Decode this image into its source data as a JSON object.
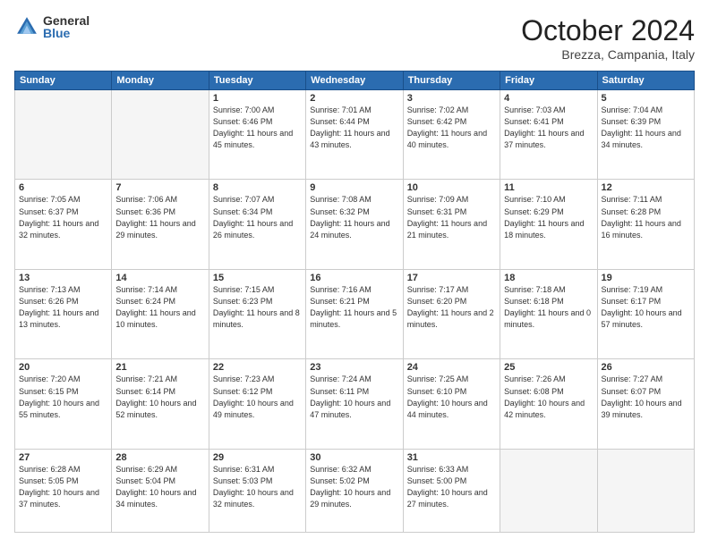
{
  "header": {
    "logo_general": "General",
    "logo_blue": "Blue",
    "month_title": "October 2024",
    "location": "Brezza, Campania, Italy"
  },
  "days_of_week": [
    "Sunday",
    "Monday",
    "Tuesday",
    "Wednesday",
    "Thursday",
    "Friday",
    "Saturday"
  ],
  "weeks": [
    [
      {
        "day": "",
        "empty": true
      },
      {
        "day": "",
        "empty": true
      },
      {
        "day": "1",
        "sunrise": "Sunrise: 7:00 AM",
        "sunset": "Sunset: 6:46 PM",
        "daylight": "Daylight: 11 hours and 45 minutes."
      },
      {
        "day": "2",
        "sunrise": "Sunrise: 7:01 AM",
        "sunset": "Sunset: 6:44 PM",
        "daylight": "Daylight: 11 hours and 43 minutes."
      },
      {
        "day": "3",
        "sunrise": "Sunrise: 7:02 AM",
        "sunset": "Sunset: 6:42 PM",
        "daylight": "Daylight: 11 hours and 40 minutes."
      },
      {
        "day": "4",
        "sunrise": "Sunrise: 7:03 AM",
        "sunset": "Sunset: 6:41 PM",
        "daylight": "Daylight: 11 hours and 37 minutes."
      },
      {
        "day": "5",
        "sunrise": "Sunrise: 7:04 AM",
        "sunset": "Sunset: 6:39 PM",
        "daylight": "Daylight: 11 hours and 34 minutes."
      }
    ],
    [
      {
        "day": "6",
        "sunrise": "Sunrise: 7:05 AM",
        "sunset": "Sunset: 6:37 PM",
        "daylight": "Daylight: 11 hours and 32 minutes."
      },
      {
        "day": "7",
        "sunrise": "Sunrise: 7:06 AM",
        "sunset": "Sunset: 6:36 PM",
        "daylight": "Daylight: 11 hours and 29 minutes."
      },
      {
        "day": "8",
        "sunrise": "Sunrise: 7:07 AM",
        "sunset": "Sunset: 6:34 PM",
        "daylight": "Daylight: 11 hours and 26 minutes."
      },
      {
        "day": "9",
        "sunrise": "Sunrise: 7:08 AM",
        "sunset": "Sunset: 6:32 PM",
        "daylight": "Daylight: 11 hours and 24 minutes."
      },
      {
        "day": "10",
        "sunrise": "Sunrise: 7:09 AM",
        "sunset": "Sunset: 6:31 PM",
        "daylight": "Daylight: 11 hours and 21 minutes."
      },
      {
        "day": "11",
        "sunrise": "Sunrise: 7:10 AM",
        "sunset": "Sunset: 6:29 PM",
        "daylight": "Daylight: 11 hours and 18 minutes."
      },
      {
        "day": "12",
        "sunrise": "Sunrise: 7:11 AM",
        "sunset": "Sunset: 6:28 PM",
        "daylight": "Daylight: 11 hours and 16 minutes."
      }
    ],
    [
      {
        "day": "13",
        "sunrise": "Sunrise: 7:13 AM",
        "sunset": "Sunset: 6:26 PM",
        "daylight": "Daylight: 11 hours and 13 minutes."
      },
      {
        "day": "14",
        "sunrise": "Sunrise: 7:14 AM",
        "sunset": "Sunset: 6:24 PM",
        "daylight": "Daylight: 11 hours and 10 minutes."
      },
      {
        "day": "15",
        "sunrise": "Sunrise: 7:15 AM",
        "sunset": "Sunset: 6:23 PM",
        "daylight": "Daylight: 11 hours and 8 minutes."
      },
      {
        "day": "16",
        "sunrise": "Sunrise: 7:16 AM",
        "sunset": "Sunset: 6:21 PM",
        "daylight": "Daylight: 11 hours and 5 minutes."
      },
      {
        "day": "17",
        "sunrise": "Sunrise: 7:17 AM",
        "sunset": "Sunset: 6:20 PM",
        "daylight": "Daylight: 11 hours and 2 minutes."
      },
      {
        "day": "18",
        "sunrise": "Sunrise: 7:18 AM",
        "sunset": "Sunset: 6:18 PM",
        "daylight": "Daylight: 11 hours and 0 minutes."
      },
      {
        "day": "19",
        "sunrise": "Sunrise: 7:19 AM",
        "sunset": "Sunset: 6:17 PM",
        "daylight": "Daylight: 10 hours and 57 minutes."
      }
    ],
    [
      {
        "day": "20",
        "sunrise": "Sunrise: 7:20 AM",
        "sunset": "Sunset: 6:15 PM",
        "daylight": "Daylight: 10 hours and 55 minutes."
      },
      {
        "day": "21",
        "sunrise": "Sunrise: 7:21 AM",
        "sunset": "Sunset: 6:14 PM",
        "daylight": "Daylight: 10 hours and 52 minutes."
      },
      {
        "day": "22",
        "sunrise": "Sunrise: 7:23 AM",
        "sunset": "Sunset: 6:12 PM",
        "daylight": "Daylight: 10 hours and 49 minutes."
      },
      {
        "day": "23",
        "sunrise": "Sunrise: 7:24 AM",
        "sunset": "Sunset: 6:11 PM",
        "daylight": "Daylight: 10 hours and 47 minutes."
      },
      {
        "day": "24",
        "sunrise": "Sunrise: 7:25 AM",
        "sunset": "Sunset: 6:10 PM",
        "daylight": "Daylight: 10 hours and 44 minutes."
      },
      {
        "day": "25",
        "sunrise": "Sunrise: 7:26 AM",
        "sunset": "Sunset: 6:08 PM",
        "daylight": "Daylight: 10 hours and 42 minutes."
      },
      {
        "day": "26",
        "sunrise": "Sunrise: 7:27 AM",
        "sunset": "Sunset: 6:07 PM",
        "daylight": "Daylight: 10 hours and 39 minutes."
      }
    ],
    [
      {
        "day": "27",
        "sunrise": "Sunrise: 6:28 AM",
        "sunset": "Sunset: 5:05 PM",
        "daylight": "Daylight: 10 hours and 37 minutes."
      },
      {
        "day": "28",
        "sunrise": "Sunrise: 6:29 AM",
        "sunset": "Sunset: 5:04 PM",
        "daylight": "Daylight: 10 hours and 34 minutes."
      },
      {
        "day": "29",
        "sunrise": "Sunrise: 6:31 AM",
        "sunset": "Sunset: 5:03 PM",
        "daylight": "Daylight: 10 hours and 32 minutes."
      },
      {
        "day": "30",
        "sunrise": "Sunrise: 6:32 AM",
        "sunset": "Sunset: 5:02 PM",
        "daylight": "Daylight: 10 hours and 29 minutes."
      },
      {
        "day": "31",
        "sunrise": "Sunrise: 6:33 AM",
        "sunset": "Sunset: 5:00 PM",
        "daylight": "Daylight: 10 hours and 27 minutes."
      },
      {
        "day": "",
        "empty": true
      },
      {
        "day": "",
        "empty": true
      }
    ]
  ]
}
